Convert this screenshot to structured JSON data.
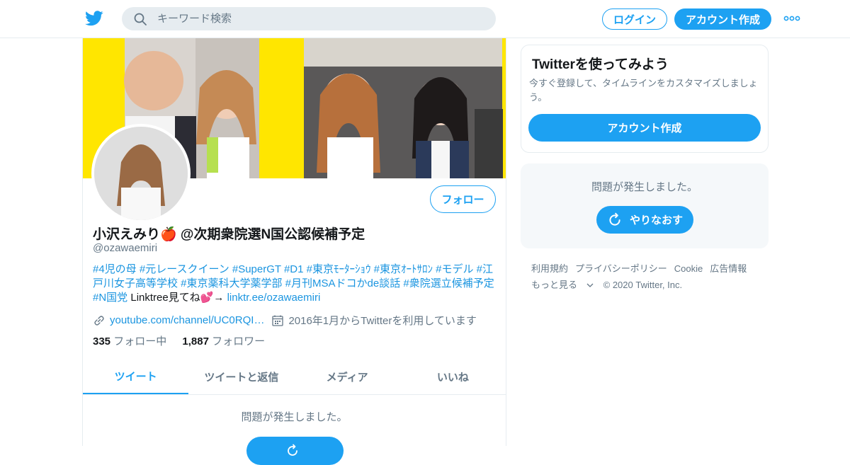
{
  "header": {
    "search_placeholder": "キーワード検索",
    "login_label": "ログイン",
    "signup_label": "アカウント作成"
  },
  "profile": {
    "name": "小沢えみり🍎 @次期衆院選N国公認候補予定",
    "handle": "@ozawaemiri",
    "follow_label": "フォロー",
    "bio_tags_1": "#4児の母 #元レースクイーン #SuperGT #D1 #東京ﾓｰﾀｰｼｮｳ #東京ｵｰﾄｻﾛﾝ #モデル #江戸川女子高等学校 #東京薬科大学薬学部 #月刊MSAドコかde談話 #衆院選立候補予定 #N国党",
    "bio_text": " Linktree見てね💕→ ",
    "bio_link": "linktr.ee/ozawaemiri",
    "website": "youtube.com/channel/UC0RQI…",
    "joined": "2016年1月からTwitterを利用しています",
    "following_count": "335",
    "following_label": "フォロー中",
    "followers_count": "1,887",
    "followers_label": "フォロワー"
  },
  "tabs": [
    "ツイート",
    "ツイートと返信",
    "メディア",
    "いいね"
  ],
  "main_error": "問題が発生しました。",
  "sidebar": {
    "card_title": "Twitterを使ってみよう",
    "card_text": "今すぐ登録して、タイムラインをカスタマイズしましょう。",
    "card_button": "アカウント作成",
    "error_text": "問題が発生しました。",
    "retry_label": "やりなおす"
  },
  "footer": {
    "links": [
      "利用規約",
      "プライバシーポリシー",
      "Cookie",
      "広告情報"
    ],
    "more": "もっと見る",
    "copyright": "© 2020 Twitter, Inc."
  },
  "colors": {
    "accent": "#1da1f2",
    "link": "#1b95e0",
    "banner_bg": "#ffe600"
  }
}
